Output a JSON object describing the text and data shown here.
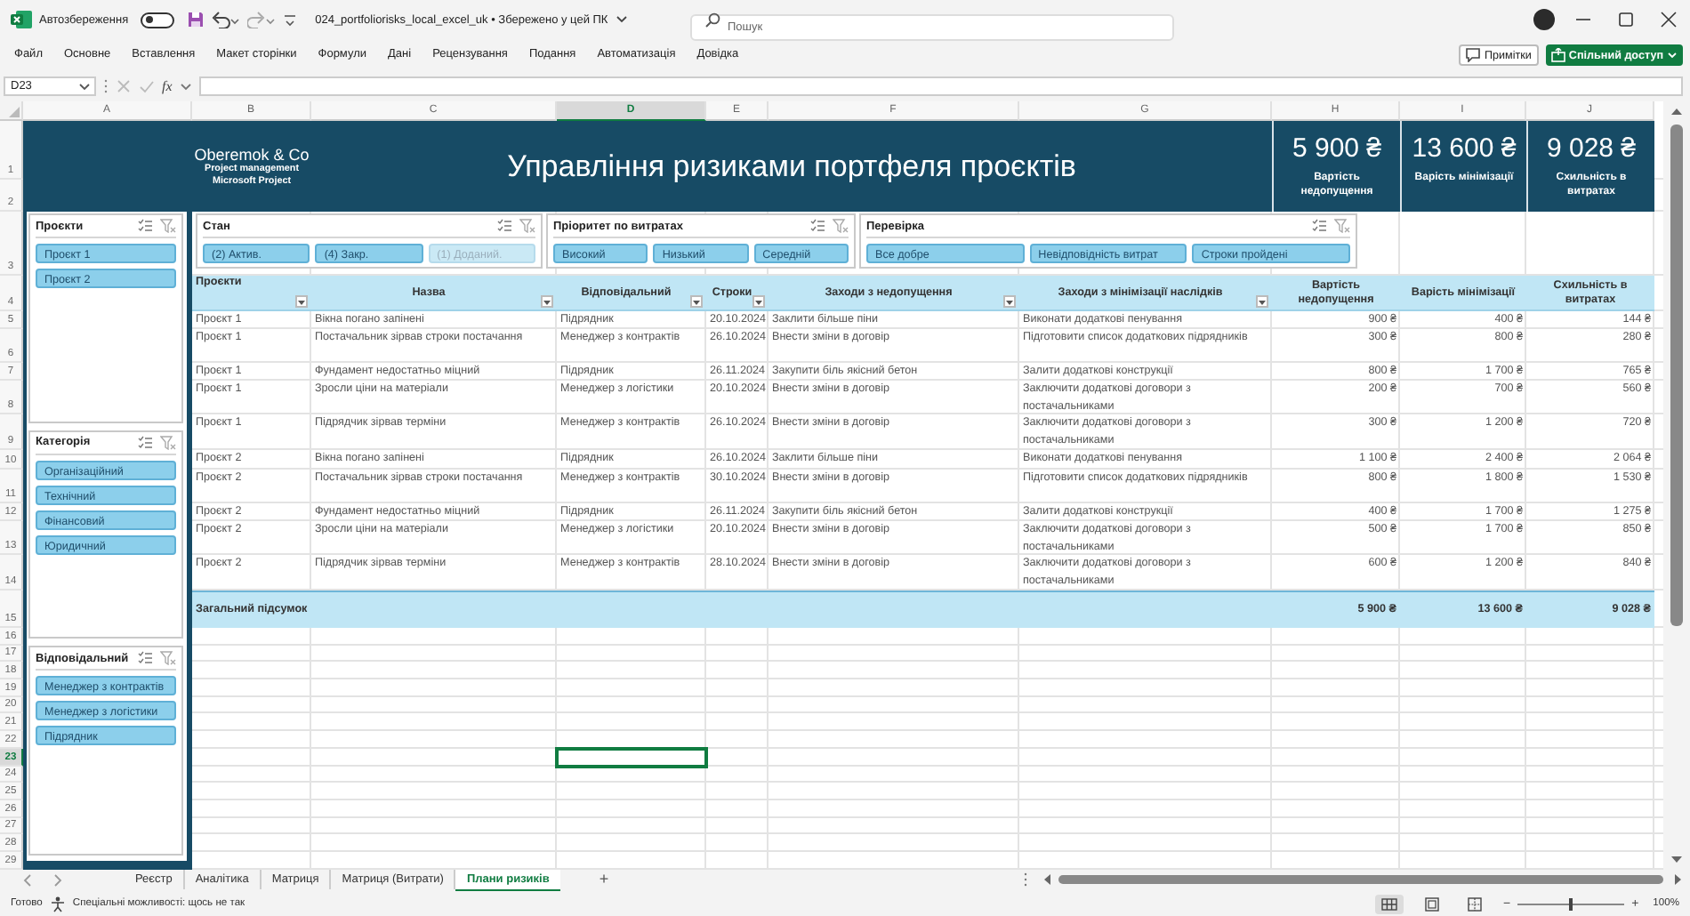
{
  "title_bar": {
    "autosave_label": "Автозбереження",
    "autosave_on": false,
    "file_title": "024_portfoliorisks_local_excel_uk • Збережено у цей ПК",
    "search": {
      "placeholder": "Пошук"
    }
  },
  "ribbon": {
    "tabs": [
      {
        "label": "Файл",
        "selected": false
      },
      {
        "label": "Основне",
        "selected": false
      },
      {
        "label": "Вставлення",
        "selected": false
      },
      {
        "label": "Макет сторінки",
        "selected": false
      },
      {
        "label": "Формули",
        "selected": false
      },
      {
        "label": "Дані",
        "selected": false
      },
      {
        "label": "Рецензування",
        "selected": false
      },
      {
        "label": "Подання",
        "selected": false
      },
      {
        "label": "Автоматизація",
        "selected": false
      },
      {
        "label": "Довідка",
        "selected": false
      }
    ],
    "comments_button": "Примітки",
    "share_button": "Спільний доступ"
  },
  "formula_bar": {
    "name_box": "D23",
    "function_label": "fx"
  },
  "sheet": {
    "columns": [
      {
        "label": "A",
        "selected": false
      },
      {
        "label": "B",
        "selected": false
      },
      {
        "label": "C",
        "selected": false
      },
      {
        "label": "D",
        "selected": true
      },
      {
        "label": "E",
        "selected": false
      },
      {
        "label": "F",
        "selected": false
      },
      {
        "label": "G",
        "selected": false
      },
      {
        "label": "H",
        "selected": false
      },
      {
        "label": "I",
        "selected": false
      },
      {
        "label": "J",
        "selected": false
      }
    ],
    "rows": [
      {
        "label": "1",
        "selected": false
      },
      {
        "label": "2",
        "selected": false
      },
      {
        "label": "3",
        "selected": false
      },
      {
        "label": "4",
        "selected": false
      },
      {
        "label": "5",
        "selected": false
      },
      {
        "label": "6",
        "selected": false
      },
      {
        "label": "7",
        "selected": false
      },
      {
        "label": "8",
        "selected": false
      },
      {
        "label": "9",
        "selected": false
      },
      {
        "label": "10",
        "selected": false
      },
      {
        "label": "11",
        "selected": false
      },
      {
        "label": "12",
        "selected": false
      },
      {
        "label": "13",
        "selected": false
      },
      {
        "label": "14",
        "selected": false
      },
      {
        "label": "15",
        "selected": false
      },
      {
        "label": "16",
        "selected": false
      },
      {
        "label": "17",
        "selected": false
      },
      {
        "label": "18",
        "selected": false
      },
      {
        "label": "19",
        "selected": false
      },
      {
        "label": "20",
        "selected": false
      },
      {
        "label": "21",
        "selected": false
      },
      {
        "label": "22",
        "selected": false
      },
      {
        "label": "23",
        "selected": true
      },
      {
        "label": "24",
        "selected": false
      },
      {
        "label": "25",
        "selected": false
      },
      {
        "label": "26",
        "selected": false
      },
      {
        "label": "27",
        "selected": false
      },
      {
        "label": "28",
        "selected": false
      },
      {
        "label": "29",
        "selected": false
      }
    ],
    "banner": {
      "company": "Oberemok & Co",
      "tagline": [
        "Project management",
        "Microsoft Project"
      ],
      "title": "Управління ризиками портфеля проєктів",
      "kpis": [
        {
          "value": "5 900 ₴",
          "label": "Вартість недопущення"
        },
        {
          "value": "13 600 ₴",
          "label": "Варість мінімізації"
        },
        {
          "value": "9 028 ₴",
          "label": "Схильність в витратах"
        }
      ]
    },
    "side_slicers": [
      {
        "title": "Проєкти",
        "items": [
          {
            "label": "Проєкт 1",
            "selected": true,
            "disabled": false
          },
          {
            "label": "Проєкт 2",
            "selected": true,
            "disabled": false
          }
        ]
      },
      {
        "title": "Категорія",
        "items": [
          {
            "label": "Організаційний",
            "selected": true,
            "disabled": false
          },
          {
            "label": "Технічний",
            "selected": true,
            "disabled": false
          },
          {
            "label": "Фінансовий",
            "selected": true,
            "disabled": false
          },
          {
            "label": "Юридичний",
            "selected": true,
            "disabled": false
          }
        ]
      },
      {
        "title": "Відповідальний",
        "items": [
          {
            "label": "Менеджер з контрактів",
            "selected": true,
            "disabled": false
          },
          {
            "label": "Менеджер з логістики",
            "selected": true,
            "disabled": false
          },
          {
            "label": "Підрядник",
            "selected": true,
            "disabled": false
          }
        ]
      }
    ],
    "top_slicers": [
      {
        "title": "Стан",
        "items": [
          {
            "label": "(2) Актив.",
            "selected": true,
            "disabled": false
          },
          {
            "label": "(4) Закр.",
            "selected": true,
            "disabled": false
          },
          {
            "label": "(1) Доданий.",
            "selected": true,
            "disabled": true
          }
        ]
      },
      {
        "title": "Пріоритет по витратах",
        "items": [
          {
            "label": "Високий",
            "selected": true,
            "disabled": false
          },
          {
            "label": "Низький",
            "selected": true,
            "disabled": false
          },
          {
            "label": "Середній",
            "selected": true,
            "disabled": false
          }
        ]
      },
      {
        "title": "Перевірка",
        "items": [
          {
            "label": "Все добре",
            "selected": true,
            "disabled": false
          },
          {
            "label": "Невідповідність витрат",
            "selected": true,
            "disabled": false
          },
          {
            "label": "Строки пройдені",
            "selected": true,
            "disabled": false
          }
        ]
      }
    ],
    "table": {
      "columns": [
        {
          "label": "Проєкти",
          "filter": true,
          "kind": "text"
        },
        {
          "label": "Назва",
          "filter": true,
          "kind": "text"
        },
        {
          "label": "Відповідальний",
          "filter": true,
          "kind": "text"
        },
        {
          "label": "Строки",
          "filter": true,
          "kind": "text"
        },
        {
          "label": "Заходи з недопущення",
          "filter": true,
          "kind": "text"
        },
        {
          "label": "Заходи з мінімізації наслідків",
          "filter": true,
          "kind": "text"
        },
        {
          "label": "Вартість недопущення",
          "filter": false,
          "kind": "money"
        },
        {
          "label": "Варість мінімізації",
          "filter": false,
          "kind": "money"
        },
        {
          "label": "Схильність в витратах",
          "filter": false,
          "kind": "money"
        }
      ],
      "rows": [
        [
          "Проєкт 1",
          "Вікна погано запінені",
          "Підрядник",
          "20.10.2024",
          "Заклити більше піни",
          "Виконати додаткові пенування",
          "900 ₴",
          "400 ₴",
          "144 ₴"
        ],
        [
          "Проєкт 1",
          "Постачальник зірвав строки постачання",
          "Менеджер з контрактів",
          "26.10.2024",
          "Внести зміни в договір",
          "Підготовити список додаткових підрядників",
          "300 ₴",
          "800 ₴",
          "280 ₴"
        ],
        [
          "Проєкт 1",
          "Фундамент недостатньо міцний",
          "Підрядник",
          "26.11.2024",
          "Закупити біль якісний бетон",
          "Залити додаткові конструкції",
          "800 ₴",
          "1 700 ₴",
          "765 ₴"
        ],
        [
          "Проєкт 1",
          "Зросли ціни на матеріали",
          "Менеджер з логістики",
          "20.10.2024",
          "Внести зміни в договір",
          "Заключити додаткові договори з постачальниками",
          "200 ₴",
          "700 ₴",
          "560 ₴"
        ],
        [
          "Проєкт 1",
          "Підрядчик зірвав терміни",
          "Менеджер з контрактів",
          "26.10.2024",
          "Внести зміни в договір",
          "Заключити додаткові договори з постачальниками",
          "300 ₴",
          "1 200 ₴",
          "720 ₴"
        ],
        [
          "Проєкт 2",
          "Вікна погано запінені",
          "Підрядник",
          "26.10.2024",
          "Заклити більше піни",
          "Виконати додаткові пенування",
          "1 100 ₴",
          "2 400 ₴",
          "2 064 ₴"
        ],
        [
          "Проєкт 2",
          "Постачальник зірвав строки постачання",
          "Менеджер з контрактів",
          "30.10.2024",
          "Внести зміни в договір",
          "Підготовити список додаткових підрядників",
          "800 ₴",
          "1 800 ₴",
          "1 530 ₴"
        ],
        [
          "Проєкт 2",
          "Фундамент недостатньо міцний",
          "Підрядник",
          "26.11.2024",
          "Закупити біль якісний бетон",
          "Залити додаткові конструкції",
          "400 ₴",
          "1 700 ₴",
          "1 275 ₴"
        ],
        [
          "Проєкт 2",
          "Зросли ціни на матеріали",
          "Менеджер з логістики",
          "20.10.2024",
          "Внести зміни в договір",
          "Заключити додаткові договори з постачальниками",
          "500 ₴",
          "1 700 ₴",
          "850 ₴"
        ],
        [
          "Проєкт 2",
          "Підрядчик зірвав терміни",
          "Менеджер з контрактів",
          "28.10.2024",
          "Внести зміни в договір",
          "Заключити додаткові договори з постачальниками",
          "600 ₴",
          "1 200 ₴",
          "840 ₴"
        ]
      ],
      "total": {
        "label": "Загальний підсумок",
        "values": [
          "5 900 ₴",
          "13 600 ₴",
          "9 028 ₴"
        ]
      }
    }
  },
  "sheet_tabs": {
    "tabs": [
      {
        "label": "Реєстр",
        "selected": false
      },
      {
        "label": "Аналітика",
        "selected": false
      },
      {
        "label": "Матриця",
        "selected": false
      },
      {
        "label": "Матриця (Витрати)",
        "selected": false
      },
      {
        "label": "Плани ризиків",
        "selected": true
      }
    ],
    "add_sheet": "+"
  },
  "status_bar": {
    "status": "Готово",
    "accessibility": "Спеціальні можливості: щось не так",
    "views": [
      {
        "kind": "normal",
        "selected": true
      },
      {
        "kind": "page_layout",
        "selected": false
      },
      {
        "kind": "page_break",
        "selected": false
      }
    ],
    "zoom": {
      "zoom_out": "−",
      "zoom_in": "+",
      "level": 0.5,
      "reading": "100%"
    }
  }
}
